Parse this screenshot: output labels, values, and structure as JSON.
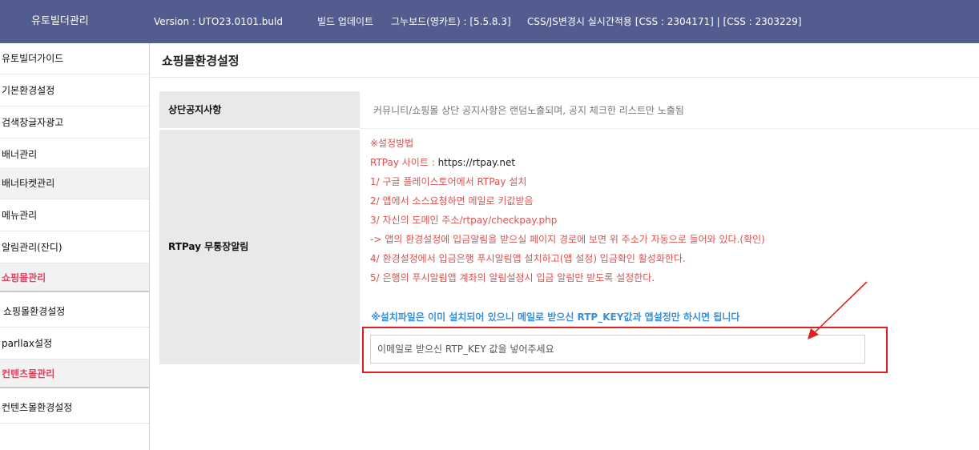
{
  "topbar": {
    "app_title": "유토빌더관리",
    "version": "Version : UTO23.0101.buld",
    "build_update": "빌드 업데이트",
    "board_version": "그누보드(영카트) : [5.5.8.3]",
    "css_info": "CSS/JS변경시 실시간적용   [CSS : 2304171] | [CSS : 2303229]",
    "background": "#525c8e"
  },
  "sidebar": {
    "items": [
      {
        "label": "유토빌더가이드"
      },
      {
        "label": "기본환경설정"
      },
      {
        "label": "검색창글자광고"
      },
      {
        "label": "배너관리"
      },
      {
        "label": "배너타켓관리"
      },
      {
        "label": "메뉴관리"
      },
      {
        "label": "알림관리(잔디)"
      },
      {
        "label": "쇼핑몰관리"
      },
      {
        "label": "쇼핑몰환경설정"
      },
      {
        "label": "parllax설정"
      },
      {
        "label": "컨텐츠몰관리"
      },
      {
        "label": "컨텐츠몰환경설정"
      }
    ],
    "section_color": "#e0435f"
  },
  "main": {
    "title": "쇼핑몰환경설정",
    "notice_label": "상단공지사항",
    "notice_desc": "커뮤니티/쇼핑몰 상단 공지사항은 랜덤노출되며, 공지 체크한 리스트만 노출됨",
    "rtpay_label": "RTPay 무통장알림",
    "steps": {
      "heading": "※설정방법",
      "site_prefix": "RTPay 사이트 : ",
      "site_url": "https://rtpay.net",
      "step1": "1/ 구글 플레이스토어에서 RTPay 설치",
      "step2": "2/ 앱에서 소스요청하면 메일로 키값받음",
      "step3": "3/ 자신의 도메인 주소/rtpay/checkpay.php",
      "step3_note": "-> 앱의 환경설정에 입금알림을 받으실 페이지 경로에 보면 위 주소가 자동으로 들어와 있다.(확인)",
      "step4": "4/ 환경설정에서 입금은행 푸시알림앱 설치하고(앱 설정) 입금확인 활성화한다.",
      "step5": "5/ 은행의 푸시알림앱 계좌의 알림설정시 입금 알림만 받도록 설정한다."
    },
    "install_note": "※설치파일은 이미 설치되어 있으니 메일로 받으신 RTP_KEY값과 앱설정만 하시면 됩니다",
    "key_input": {
      "value": "",
      "placeholder": "이메일로 받으신 RTP_KEY 값을 넣어주세요"
    },
    "step_color": "#d9534f",
    "note_color": "#3a8fd9",
    "highlight_color": "#e02020"
  }
}
